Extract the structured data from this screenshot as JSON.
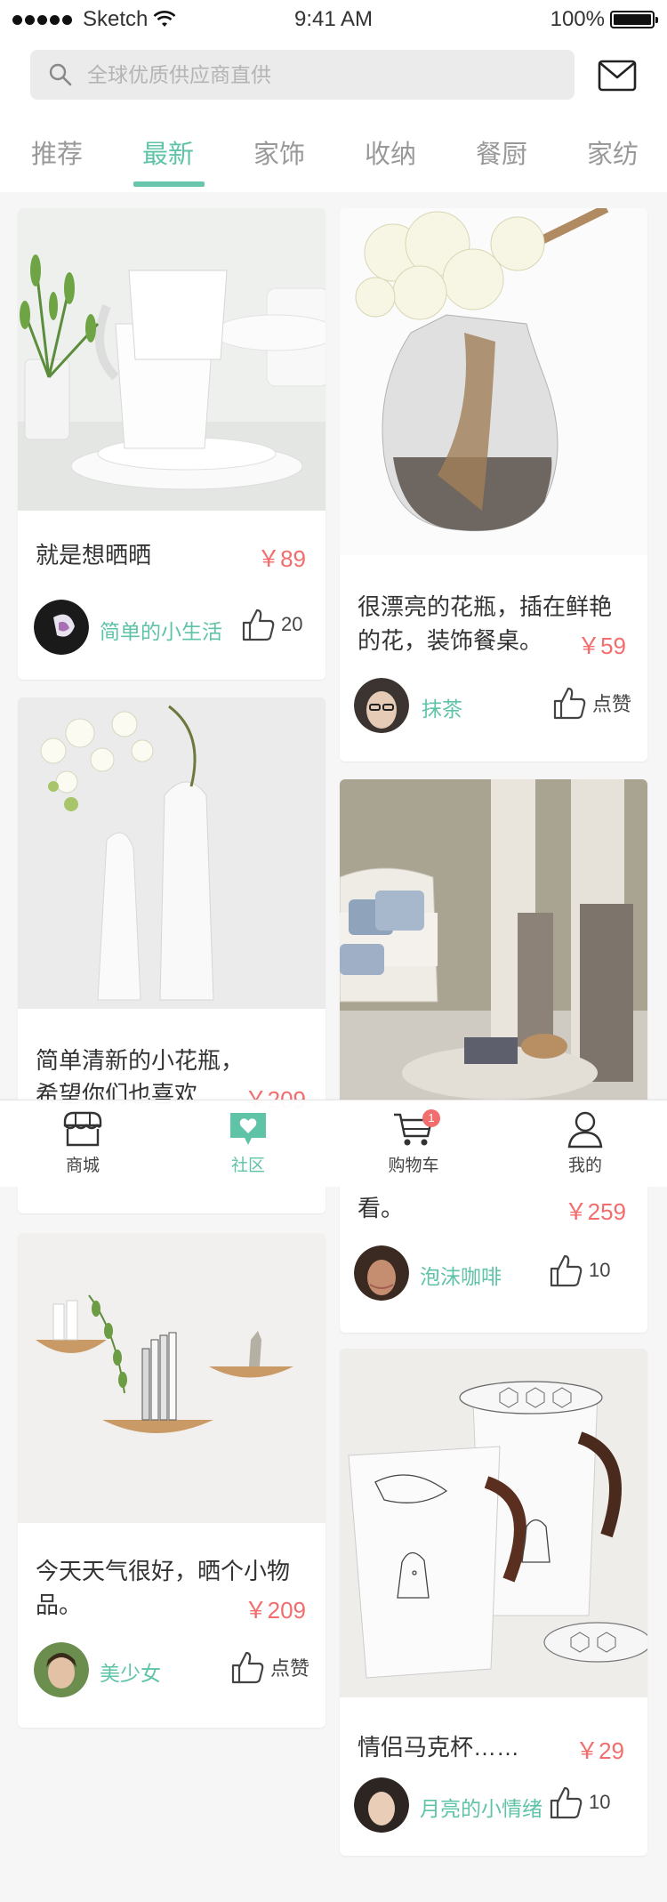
{
  "status_bar": {
    "carrier": "Sketch",
    "time": "9:41 AM",
    "battery": "100%"
  },
  "search": {
    "placeholder": "全球优质供应商直供"
  },
  "tabs": [
    {
      "label": "推荐"
    },
    {
      "label": "最新"
    },
    {
      "label": "家饰"
    },
    {
      "label": "收纳"
    },
    {
      "label": "餐厨"
    },
    {
      "label": "家纺"
    }
  ],
  "active_tab": "最新",
  "colors": {
    "accent": "#5fc3a8",
    "price": "#f26d6d",
    "background": "#f6f6f6"
  },
  "cards": [
    {
      "title": "就是想晒晒",
      "price": "￥89",
      "user": "简单的小生活",
      "likes": "20"
    },
    {
      "title_line1": "很漂亮的花瓶，插在鲜艳",
      "title_line2": "的花，装饰餐桌。",
      "price": "￥59",
      "user": "抹茶",
      "likes": "点赞"
    },
    {
      "title_line1": "简单清新的小花瓶，",
      "title_line2": "希望你们也喜欢",
      "price": "￥209"
    },
    {
      "title_line2": "看。",
      "price": "￥259",
      "user": "泡沫咖啡",
      "likes": "10"
    },
    {
      "title_line1": "今天天气很好，晒个小物",
      "title_line2": "品。",
      "price": "￥209",
      "user": "美少女",
      "likes": "点赞"
    },
    {
      "title": "情侣马克杯……",
      "price": "￥29",
      "user": "月亮的小情绪",
      "likes": "10"
    }
  ],
  "tab_bar": [
    {
      "label": "商城",
      "icon": "store-icon"
    },
    {
      "label": "社区",
      "icon": "community-chat-icon",
      "active": true
    },
    {
      "label": "购物车",
      "icon": "cart-icon",
      "badge": "1"
    },
    {
      "label": "我的",
      "icon": "user-icon"
    }
  ]
}
